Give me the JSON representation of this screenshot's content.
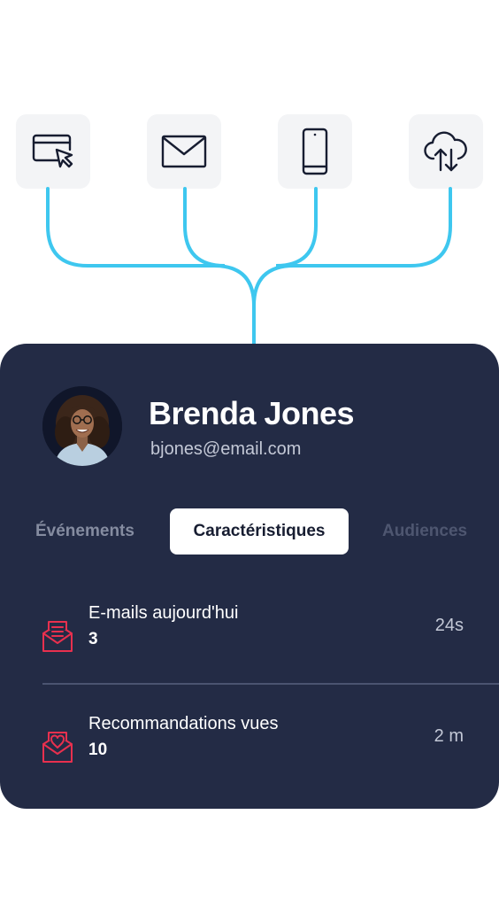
{
  "channels": [
    {
      "icon": "browser-cursor-icon"
    },
    {
      "icon": "envelope-icon"
    },
    {
      "icon": "smartphone-icon"
    },
    {
      "icon": "cloud-sync-icon"
    }
  ],
  "colors": {
    "connector": "#3ec7ef",
    "card_background": "#232b45",
    "tile_background": "#f3f4f6",
    "accent_red": "#e8304e"
  },
  "profile": {
    "name": "Brenda Jones",
    "email": "bjones@email.com"
  },
  "tabs": [
    {
      "label": "Événements",
      "active": false
    },
    {
      "label": "Caractéristiques",
      "active": true
    },
    {
      "label": "Audiences",
      "active": false
    }
  ],
  "attributes": [
    {
      "icon": "email-open-icon",
      "label": "E-mails aujourd'hui",
      "value": "3",
      "time": "24s"
    },
    {
      "icon": "heart-mail-icon",
      "label": "Recommandations vues",
      "value": "10",
      "time": "2 m"
    }
  ]
}
